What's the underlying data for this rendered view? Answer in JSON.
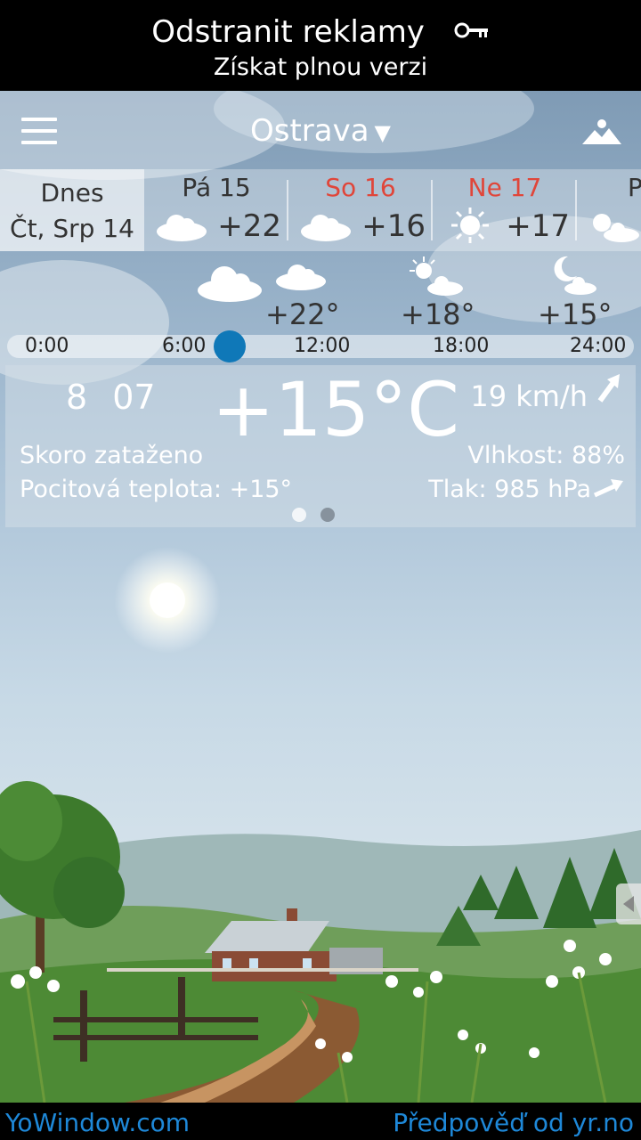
{
  "ad": {
    "title": "Odstranit reklamy",
    "subtitle": "Získat plnou verzi",
    "icon": "key-icon"
  },
  "header": {
    "menu_icon": "hamburger-menu-icon",
    "city": "Ostrava",
    "city_dropdown_icon": "triangle-down-icon",
    "landscape_icon": "landscape-icon"
  },
  "days": {
    "today": {
      "label": "Dnes",
      "date": "Čt, Srp 14"
    },
    "list": [
      {
        "name": "Pá 15",
        "temp": "+22",
        "icon": "cloud-icon",
        "weekend": false
      },
      {
        "name": "So 16",
        "temp": "+16",
        "icon": "cloud-icon",
        "weekend": true
      },
      {
        "name": "Ne 17",
        "temp": "+17",
        "icon": "sun-icon",
        "weekend": true
      },
      {
        "name": "Po",
        "temp": "",
        "icon": "sun-cloud-icon",
        "weekend": false
      }
    ]
  },
  "hourly": {
    "temps": [
      "+22°",
      "+18°",
      "+15°"
    ],
    "icons": [
      "cloud-icon",
      "cloud-icon",
      "sun-cloud-icon",
      "moon-cloud-icon"
    ],
    "ticks": [
      "0:00",
      "6:00",
      "12:00",
      "18:00",
      "24:00"
    ]
  },
  "current": {
    "time": "8 07",
    "temp": "+15°C",
    "wind": "19 km/h",
    "condition": "Skoro zataženo",
    "feels_like": "Pocitová teplota: +15°",
    "humidity": "Vlhkost: 88%",
    "pressure": "Tlak: 985 hPa"
  },
  "footer": {
    "left": "YoWindow.com",
    "right": "Předpověď od yr.no"
  },
  "colors": {
    "accent": "#0f78b8",
    "weekend": "#e0463a",
    "link": "#1e88d8"
  }
}
